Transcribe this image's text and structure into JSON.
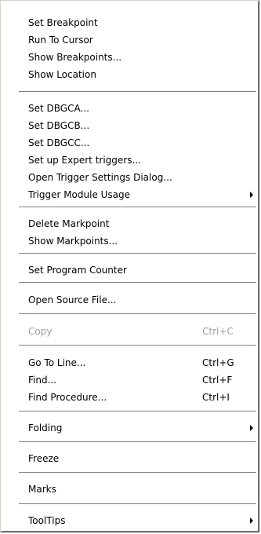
{
  "menu": {
    "groups": [
      {
        "items": [
          {
            "label": "Set Breakpoint"
          },
          {
            "label": "Run To Cursor"
          },
          {
            "label": "Show Breakpoints..."
          },
          {
            "label": "Show Location"
          }
        ]
      },
      {
        "items": [
          {
            "label": "Set DBGCA..."
          },
          {
            "label": "Set DBGCB..."
          },
          {
            "label": "Set DBGCC..."
          },
          {
            "label": "Set up Expert triggers..."
          },
          {
            "label": "Open Trigger Settings Dialog..."
          },
          {
            "label": "Trigger Module Usage",
            "submenu": true
          }
        ]
      },
      {
        "items": [
          {
            "label": "Delete Markpoint"
          },
          {
            "label": "Show Markpoints..."
          }
        ]
      },
      {
        "items": [
          {
            "label": "Set Program Counter"
          }
        ]
      },
      {
        "items": [
          {
            "label": "Open Source File..."
          }
        ]
      },
      {
        "items": [
          {
            "label": "Copy",
            "shortcut": "Ctrl+C",
            "disabled": true
          }
        ]
      },
      {
        "items": [
          {
            "label": "Go To Line...",
            "shortcut": "Ctrl+G"
          },
          {
            "label": "Find...",
            "shortcut": "Ctrl+F"
          },
          {
            "label": "Find Procedure...",
            "shortcut": "Ctrl+I"
          }
        ]
      },
      {
        "items": [
          {
            "label": "Folding",
            "submenu": true
          }
        ]
      },
      {
        "items": [
          {
            "label": "Freeze"
          }
        ]
      },
      {
        "items": [
          {
            "label": "Marks"
          }
        ]
      },
      {
        "items": [
          {
            "label": "ToolTips",
            "submenu": true
          }
        ]
      }
    ]
  }
}
